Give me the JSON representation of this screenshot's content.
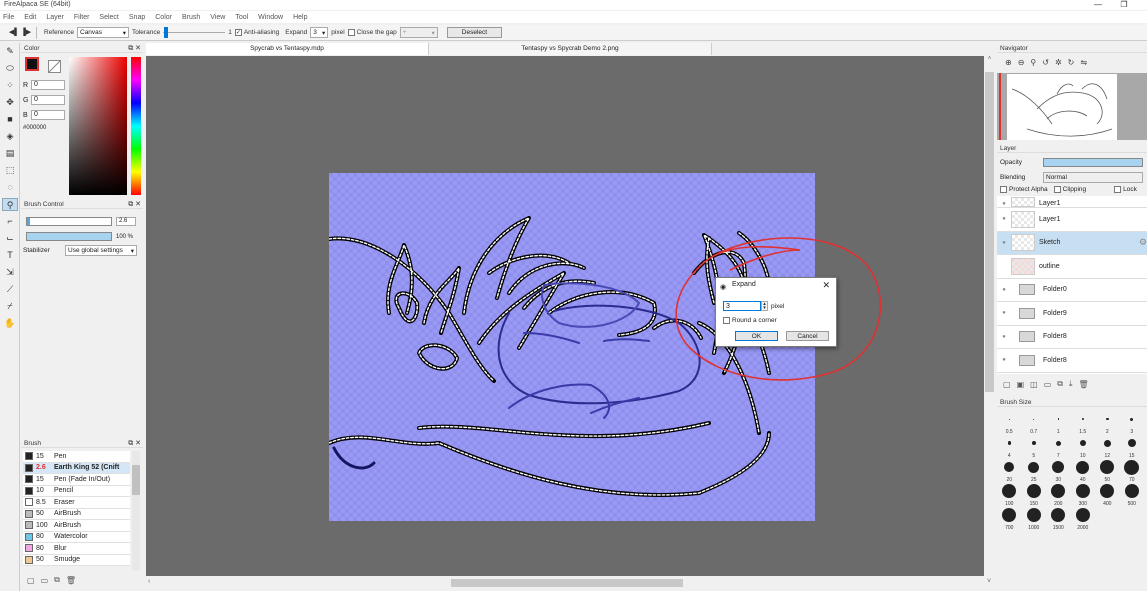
{
  "window": {
    "title": "FireAlpaca SE (64bit)",
    "controls": [
      "—",
      "❐"
    ]
  },
  "menu": [
    "File",
    "Edit",
    "Layer",
    "Filter",
    "Select",
    "Snap",
    "Color",
    "Brush",
    "View",
    "Tool",
    "Window",
    "Help"
  ],
  "toolbar": {
    "reference_label": "Reference",
    "reference_value": "Canvas",
    "tolerance_label": "Tolerance",
    "tolerance_value": "1",
    "antialias_label": "Anti-aliasing",
    "expand_label": "Expand",
    "expand_value": "3",
    "pixel_label": "pixel",
    "closegap_label": "Close the gap",
    "closegap_value": "+",
    "deselect_label": "Deselect"
  },
  "color_panel": {
    "title": "Color",
    "r_label": "R",
    "r_value": "0",
    "g_label": "G",
    "g_value": "0",
    "b_label": "B",
    "b_value": "0",
    "hex": "#000000"
  },
  "brush_control": {
    "title": "Brush Control",
    "size_value": "2.6",
    "opacity_value": "100 %",
    "stabilizer_label": "Stabilizer",
    "stabilizer_value": "Use global settings"
  },
  "brush_panel": {
    "title": "Brush",
    "items": [
      {
        "size": "15",
        "name": "Pen",
        "color": "#222222"
      },
      {
        "size": "2.6",
        "name": "Earth King 52 (Cnift",
        "color": "#222222",
        "selected": true
      },
      {
        "size": "15",
        "name": "Pen (Fade In/Out)",
        "color": "#222222"
      },
      {
        "size": "10",
        "name": "Pencil",
        "color": "#222222"
      },
      {
        "size": "8.5",
        "name": "Eraser",
        "color": "#ffffff"
      },
      {
        "size": "50",
        "name": "AirBrush",
        "color": "#bbbbbb"
      },
      {
        "size": "100",
        "name": "AirBrush",
        "color": "#bbbbbb"
      },
      {
        "size": "80",
        "name": "Watercolor",
        "color": "#6fc7e8"
      },
      {
        "size": "80",
        "name": "Blur",
        "color": "#f1a7e4"
      },
      {
        "size": "50",
        "name": "Smudge",
        "color": "#f0c890"
      }
    ]
  },
  "tabs": [
    "Spycrab vs Tentaspy.mdp",
    "Tentaspy vs Spycrab Demo 2.png"
  ],
  "dialog": {
    "title": "Expand",
    "value": "3",
    "unit": "pixel",
    "round_label": "Round a corner",
    "ok_label": "OK",
    "cancel_label": "Cancel"
  },
  "navigator": {
    "title": "Navigator"
  },
  "layer_panel": {
    "title": "Layer",
    "opacity_label": "Opacity",
    "blending_label": "Blending",
    "blending_value": "Normal",
    "protect_alpha_label": "Protect Alpha",
    "clipping_label": "Clipping",
    "lock_label": "Lock",
    "layers": [
      {
        "name": "Layer1",
        "type": "layer"
      },
      {
        "name": "Layer1",
        "type": "layer"
      },
      {
        "name": "Sketch",
        "type": "layer",
        "selected": true
      },
      {
        "name": "outline",
        "type": "layer"
      },
      {
        "name": "Folder0",
        "type": "folder"
      },
      {
        "name": "Folder9",
        "type": "folder"
      },
      {
        "name": "Folder8",
        "type": "folder"
      },
      {
        "name": "Folder8",
        "type": "folder"
      }
    ]
  },
  "brush_size": {
    "title": "Brush Size",
    "sizes": [
      "0.5",
      "0.7",
      "1",
      "1.5",
      "2",
      "3",
      "4",
      "5",
      "7",
      "10",
      "12",
      "15",
      "20",
      "25",
      "30",
      "40",
      "50",
      "70",
      "100",
      "150",
      "200",
      "300",
      "400",
      "500",
      "700",
      "1000",
      "1500",
      "2000"
    ]
  },
  "colors": {
    "canvas_fill": "#9999f4",
    "selection_marquee": "#ffffff",
    "annotation": "#e03131",
    "accent": "#0078d7"
  }
}
